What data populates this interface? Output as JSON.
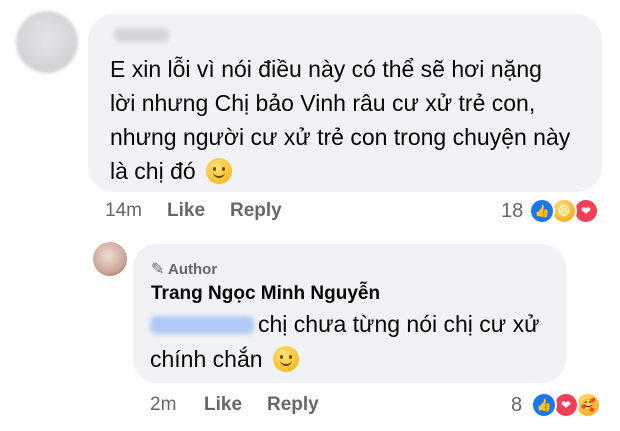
{
  "comment1": {
    "text_lines": [
      "E xin lỗi vì nói điều này có thể sẽ hơi nặng",
      "lời nhưng Chị bảo Vinh râu cư xử trẻ con,",
      "nhưng người cư xử trẻ con trong chuyện này",
      "là chị đó"
    ],
    "time": "14m",
    "like_label": "Like",
    "reply_label": "Reply",
    "reaction_count": "18",
    "reactions": [
      "like-icon",
      "haha-icon",
      "love-icon"
    ]
  },
  "reply1": {
    "author_badge": "Author",
    "author_name": "Trang Ngọc Minh Nguyễn",
    "text_line1": "chị chưa từng nói chị cư xử",
    "text_line2": "chính chắn",
    "time": "2m",
    "like_label": "Like",
    "reply_label": "Reply",
    "reaction_count": "8",
    "reactions": [
      "like-icon",
      "love-icon",
      "care-icon"
    ]
  },
  "colors": {
    "bubble": "#f0f2f5",
    "meta_text": "#65676b",
    "like_blue": "#1877f2",
    "love_red": "#f33e58"
  }
}
